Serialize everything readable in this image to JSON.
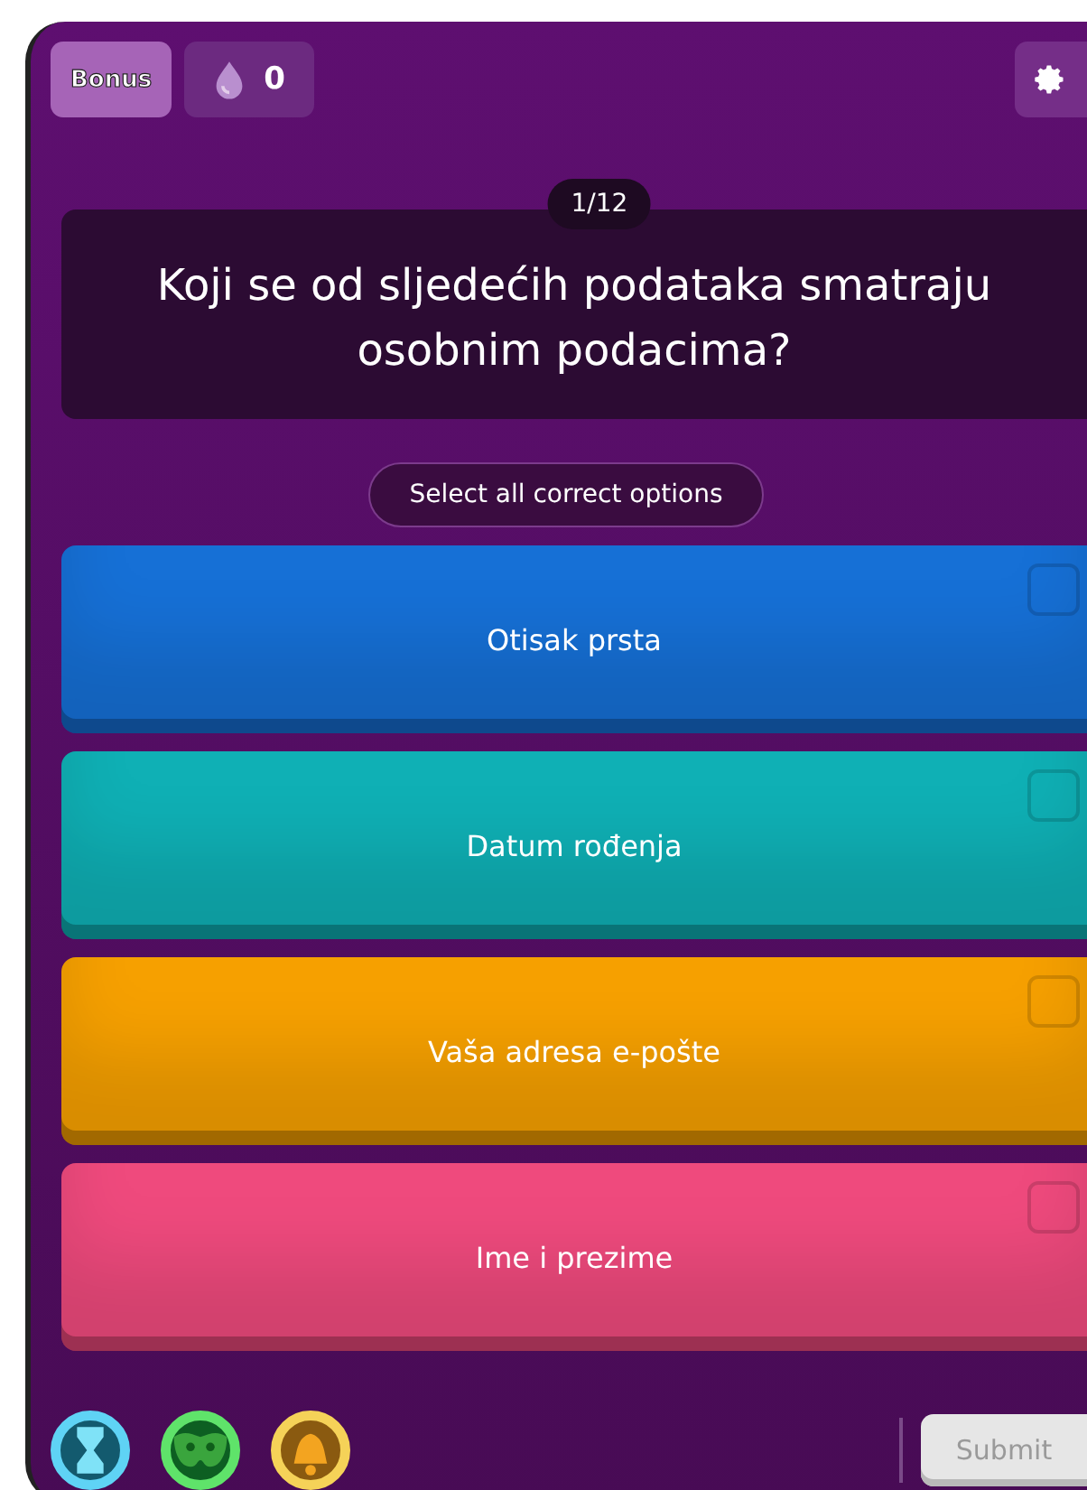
{
  "top_bar": {
    "bonus": "Bonus",
    "drops": "0"
  },
  "question": {
    "counter": "1/12",
    "text": "Koji se od sljedećih podataka smatraju osobnim podacima?"
  },
  "hint": "Select all correct options",
  "options": [
    {
      "label": "Otisak prsta",
      "color": "#1670d6",
      "checked": false
    },
    {
      "label": "Datum rođenja",
      "color": "#0fb0b5",
      "checked": false
    },
    {
      "label": "Vaša adresa e-pošte",
      "color": "#f6a000",
      "checked": false
    },
    {
      "label": "Ime i prezime",
      "color": "#ef4a7d",
      "checked": false
    }
  ],
  "powerups": [
    {
      "kind": "hourglass",
      "color": "#5fd3f5"
    },
    {
      "kind": "mask",
      "color": "#5fe36a"
    },
    {
      "kind": "bell",
      "color": "#f5d258"
    }
  ],
  "submit": {
    "label": "Submit",
    "disabled": true
  }
}
